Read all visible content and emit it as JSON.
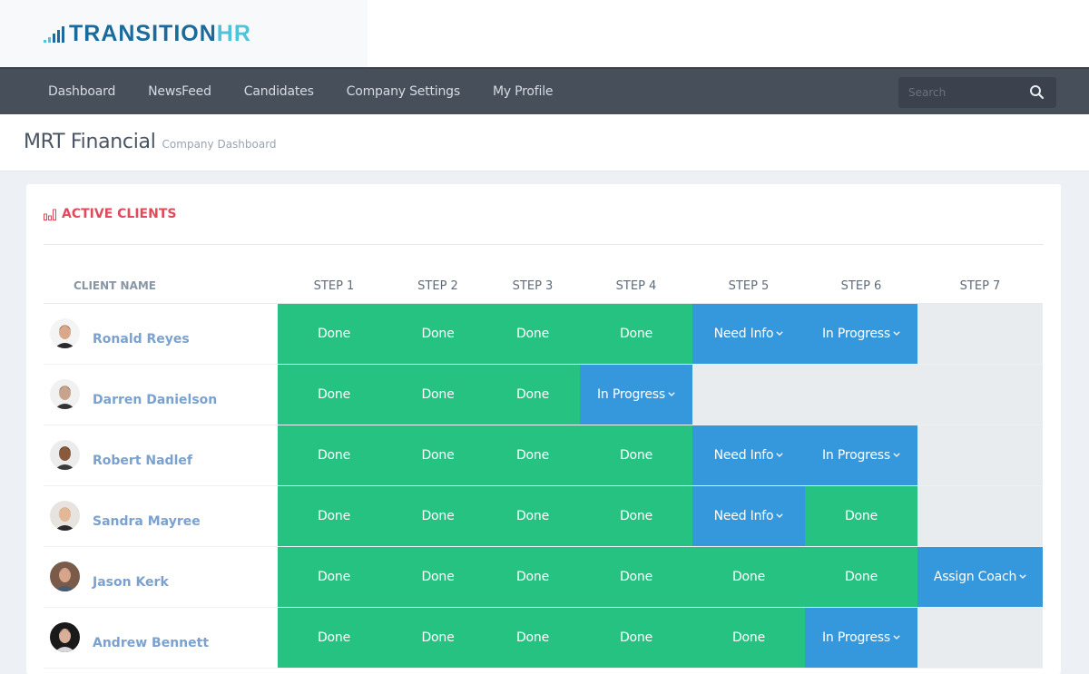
{
  "brand": {
    "name_main": "TRANSITION",
    "name_accent": "HR",
    "primary_color": "#1a6b9c",
    "accent_color": "#4fc3d9"
  },
  "nav": {
    "items": [
      {
        "label": "Dashboard"
      },
      {
        "label": "NewsFeed"
      },
      {
        "label": "Candidates"
      },
      {
        "label": "Company Settings"
      },
      {
        "label": "My Profile"
      }
    ],
    "search": {
      "placeholder": "Search",
      "value": "",
      "icon": "search-icon"
    }
  },
  "page": {
    "title": "MRT Financial",
    "subtitle": "Company Dashboard"
  },
  "card": {
    "title": "ACTIVE CLIENTS",
    "icon": "bar-chart-icon",
    "title_color": "#e04a5a"
  },
  "statuses": {
    "done": {
      "color": "#26c281"
    },
    "blue": {
      "color": "#3698dc"
    },
    "empty": {
      "color": "#e9ecef"
    }
  },
  "table": {
    "columns": [
      "CLIENT NAME",
      "STEP 1",
      "STEP 2",
      "STEP 3",
      "STEP 4",
      "STEP 5",
      "STEP 6",
      "STEP 7"
    ],
    "rows": [
      {
        "name": "Ronald Reyes",
        "avatar": "avatar-ronald",
        "steps": [
          {
            "label": "Done",
            "kind": "done"
          },
          {
            "label": "Done",
            "kind": "done"
          },
          {
            "label": "Done",
            "kind": "done"
          },
          {
            "label": "Done",
            "kind": "done"
          },
          {
            "label": "Need Info",
            "kind": "blue",
            "dropdown": true
          },
          {
            "label": "In Progress",
            "kind": "blue",
            "dropdown": true
          },
          {
            "label": "",
            "kind": "empty"
          }
        ]
      },
      {
        "name": "Darren Danielson",
        "avatar": "avatar-darren",
        "steps": [
          {
            "label": "Done",
            "kind": "done"
          },
          {
            "label": "Done",
            "kind": "done"
          },
          {
            "label": "Done",
            "kind": "done"
          },
          {
            "label": "In Progress",
            "kind": "blue",
            "dropdown": true
          },
          {
            "label": "",
            "kind": "empty"
          },
          {
            "label": "",
            "kind": "empty"
          },
          {
            "label": "",
            "kind": "empty"
          }
        ]
      },
      {
        "name": "Robert Nadlef",
        "avatar": "avatar-robert",
        "steps": [
          {
            "label": "Done",
            "kind": "done"
          },
          {
            "label": "Done",
            "kind": "done"
          },
          {
            "label": "Done",
            "kind": "done"
          },
          {
            "label": "Done",
            "kind": "done"
          },
          {
            "label": "Need Info",
            "kind": "blue",
            "dropdown": true
          },
          {
            "label": "In Progress",
            "kind": "blue",
            "dropdown": true
          },
          {
            "label": "",
            "kind": "empty"
          }
        ]
      },
      {
        "name": "Sandra Mayree",
        "avatar": "avatar-sandra",
        "steps": [
          {
            "label": "Done",
            "kind": "done"
          },
          {
            "label": "Done",
            "kind": "done"
          },
          {
            "label": "Done",
            "kind": "done"
          },
          {
            "label": "Done",
            "kind": "done"
          },
          {
            "label": "Need Info",
            "kind": "blue",
            "dropdown": true
          },
          {
            "label": "Done",
            "kind": "done"
          },
          {
            "label": "",
            "kind": "empty"
          }
        ]
      },
      {
        "name": "Jason Kerk",
        "avatar": "avatar-jason",
        "steps": [
          {
            "label": "Done",
            "kind": "done"
          },
          {
            "label": "Done",
            "kind": "done"
          },
          {
            "label": "Done",
            "kind": "done"
          },
          {
            "label": "Done",
            "kind": "done"
          },
          {
            "label": "Done",
            "kind": "done"
          },
          {
            "label": "Done",
            "kind": "done"
          },
          {
            "label": "Assign Coach",
            "kind": "blue",
            "dropdown": true
          }
        ]
      },
      {
        "name": "Andrew Bennett",
        "avatar": "avatar-andrew",
        "steps": [
          {
            "label": "Done",
            "kind": "done"
          },
          {
            "label": "Done",
            "kind": "done"
          },
          {
            "label": "Done",
            "kind": "done"
          },
          {
            "label": "Done",
            "kind": "done"
          },
          {
            "label": "Done",
            "kind": "done"
          },
          {
            "label": "In Progress",
            "kind": "blue",
            "dropdown": true
          },
          {
            "label": "",
            "kind": "empty"
          }
        ]
      }
    ]
  }
}
